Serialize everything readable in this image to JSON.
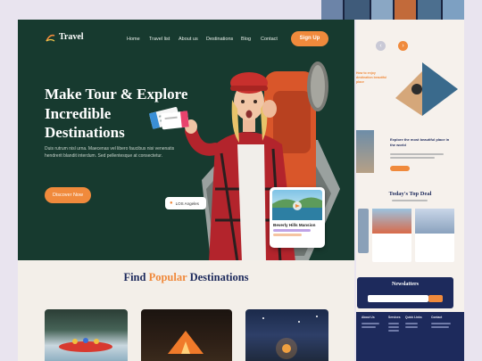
{
  "brand": {
    "name": "Travel"
  },
  "nav": {
    "items": [
      "Home",
      "Travel list",
      "About us",
      "Destinations",
      "Blog",
      "Contact"
    ],
    "cta": "Sign Up"
  },
  "hero": {
    "title_lines": [
      "Make Tour & Explore",
      "Incredible",
      "Destinations"
    ],
    "subtitle": "Duis rutrum nisl urna. Maecenas vel libero faucibus nisi venenatis hendrerit blandit interdum. Sed pellentesque at consectetur.",
    "cta": "Discover Now",
    "location": "LOS Angeles",
    "card_title": "Beverly Hills Mansion"
  },
  "popular": {
    "prefix": "Find ",
    "highlight": "Popular",
    "suffix": " Destinations"
  },
  "page2": {
    "intro": "How to enjoy destination beautiful place",
    "explore_title": "Explore the most beautiful place in the world",
    "top_deal": "Today's Top Deal",
    "newsletter": "Newslatters",
    "footer_cols": [
      "About Us",
      "Services",
      "Quick Links",
      "Contact"
    ]
  },
  "colors": {
    "hero_bg": "#173a2f",
    "accent": "#f08a3c",
    "navy": "#1d2a5c",
    "cream": "#f3efe9"
  }
}
